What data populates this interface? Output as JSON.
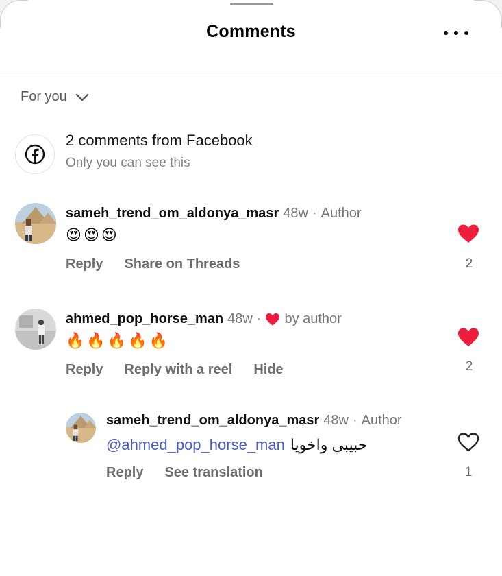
{
  "header": {
    "title": "Comments",
    "more_icon": "more-horizontal-icon"
  },
  "filter": {
    "label": "For you",
    "icon": "chevron-down-icon"
  },
  "facebook_notice": {
    "icon": "facebook-icon",
    "title": "2 comments from Facebook",
    "subtitle": "Only you can see this"
  },
  "comments": [
    {
      "username": "sameh_trend_om_aldonya_masr",
      "time": "48w",
      "separator": "·",
      "tag": "Author",
      "body_emojis": [
        "😍",
        "😍",
        "😍"
      ],
      "actions": [
        "Reply",
        "Share on Threads"
      ],
      "liked": true,
      "like_count": "2"
    },
    {
      "username": "ahmed_pop_horse_man",
      "time": "48w",
      "separator": "·",
      "tag": "by author",
      "tag_icon": "heart-filled-icon",
      "body_emojis": [
        "🔥",
        "🔥",
        "🔥",
        "🔥",
        "🔥"
      ],
      "actions": [
        "Reply",
        "Reply with a reel",
        "Hide"
      ],
      "liked": true,
      "like_count": "2"
    },
    {
      "username": "sameh_trend_om_aldonya_masr",
      "time": "48w",
      "separator": "·",
      "tag": "Author",
      "mention": "@ahmed_pop_horse_man",
      "text": "حبيبي واخويا",
      "actions": [
        "Reply",
        "See translation"
      ],
      "liked": false,
      "like_count": "1"
    }
  ],
  "colors": {
    "like_red": "#ee1d3c",
    "mention_blue": "#4a5cc4",
    "muted_text": "#777777"
  }
}
